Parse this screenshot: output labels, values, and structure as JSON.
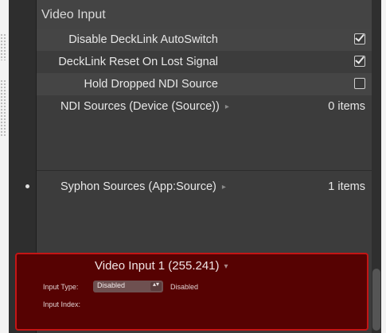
{
  "section": {
    "title": "Video Input"
  },
  "settings": [
    {
      "label": "Disable DeckLink AutoSwitch",
      "checked": true
    },
    {
      "label": "DeckLink Reset On Lost Signal",
      "checked": true
    },
    {
      "label": "Hold Dropped NDI Source",
      "checked": false
    }
  ],
  "ndi_sources": {
    "label": "NDI Sources (Device (Source))",
    "count": "0 items",
    "arrow": "▸"
  },
  "syphon_sources": {
    "label": "Syphon Sources (App:Source)",
    "count": "1 items",
    "arrow": "▸"
  },
  "video_input_item": {
    "title": "Video Input 1 (255.241)",
    "title_arrow": "▾",
    "input_type_label": "Input Type:",
    "input_type_value": "Disabled",
    "input_type_stepper": "▴▾",
    "status_text": "Disabled",
    "input_index_label": "Input Index:"
  }
}
